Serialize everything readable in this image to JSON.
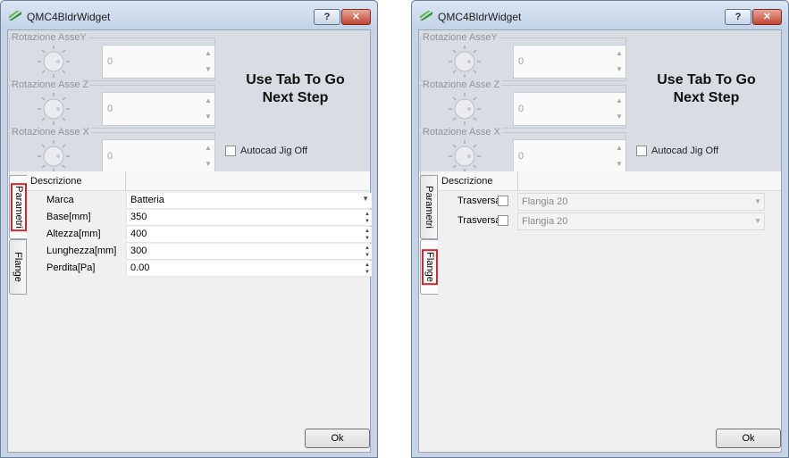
{
  "window": {
    "title": "QMC4BldrWidget",
    "help_label": "?",
    "close_label": "✕"
  },
  "groups": [
    {
      "label": "Rotazione AsseY",
      "value": "0"
    },
    {
      "label": "Rotazione Asse Z",
      "value": "0"
    },
    {
      "label": "Rotazione Asse X",
      "value": "0"
    }
  ],
  "message": {
    "line1": "Use Tab To Go",
    "line2": "Next Step"
  },
  "autocad_jig": {
    "label": "Autocad Jig Off",
    "checked": false
  },
  "tabs": {
    "parametri": "Parametri",
    "flange": "Flange"
  },
  "header": {
    "descrizione": "Descrizione"
  },
  "parametri_rows": [
    {
      "label": "Marca",
      "value": "Batteria",
      "kind": "combo"
    },
    {
      "label": "Base[mm]",
      "value": "350",
      "kind": "spin"
    },
    {
      "label": "Altezza[mm]",
      "value": "400",
      "kind": "spin"
    },
    {
      "label": "Lunghezza[mm]",
      "value": "300",
      "kind": "spin"
    },
    {
      "label": "Perdita[Pa]",
      "value": "0.00",
      "kind": "spin"
    }
  ],
  "flange_rows": [
    {
      "label": "Trasversale",
      "value": "Flangia 20",
      "checked": false
    },
    {
      "label": "Trasversale",
      "value": "Flangia 20",
      "checked": false
    }
  ],
  "ok_label": "Ok",
  "colors": {
    "highlight": "#d8252c",
    "close": "#c24431"
  }
}
